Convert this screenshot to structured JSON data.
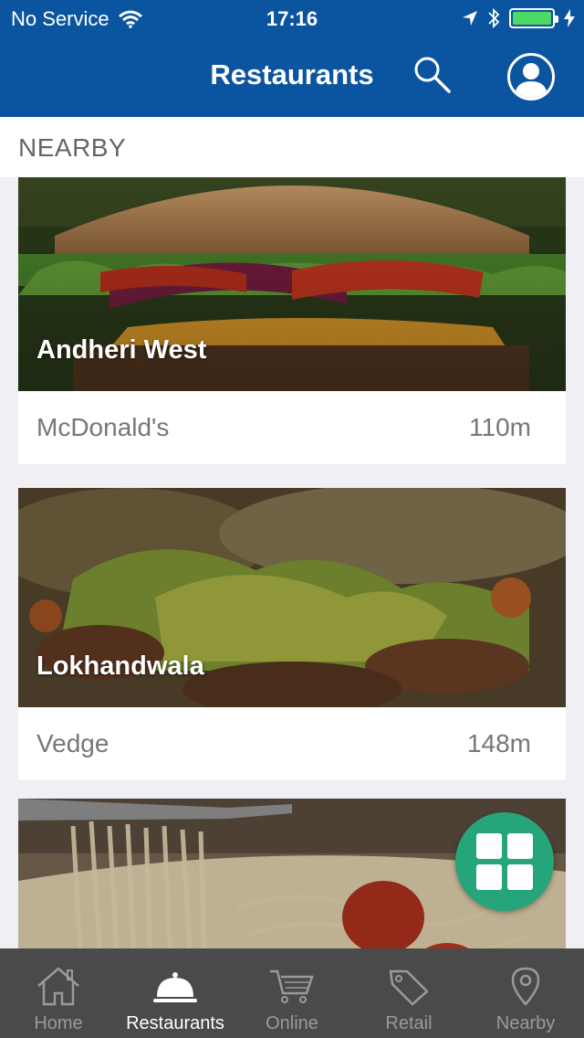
{
  "status_bar": {
    "carrier": "No Service",
    "time": "17:16",
    "battery_level": 1.0,
    "battery_color": "#4cd964"
  },
  "header": {
    "title": "Restaurants",
    "search_icon": "search-icon",
    "profile_icon": "profile-icon"
  },
  "section": {
    "label": "NEARBY"
  },
  "cards": [
    {
      "area": "Andheri West",
      "name": "McDonald's",
      "distance": "110m",
      "image": "burger"
    },
    {
      "area": "Lokhandwala",
      "name": "Vedge",
      "distance": "148m",
      "image": "stir-fry"
    },
    {
      "area": "",
      "name": "",
      "distance": "",
      "image": "spaghetti"
    }
  ],
  "fab": {
    "icon": "grid-icon",
    "color": "#25a579"
  },
  "tabbar": {
    "active": "Restaurants",
    "items": [
      {
        "label": "Home",
        "icon": "home-icon"
      },
      {
        "label": "Restaurants",
        "icon": "cloche-icon"
      },
      {
        "label": "Online",
        "icon": "cart-icon"
      },
      {
        "label": "Retail",
        "icon": "tag-icon"
      },
      {
        "label": "Nearby",
        "icon": "location-pin-icon"
      }
    ]
  },
  "colors": {
    "header_bg": "#0b55a0",
    "tabbar_bg": "#4a4a4a",
    "page_bg": "#efeff4"
  }
}
